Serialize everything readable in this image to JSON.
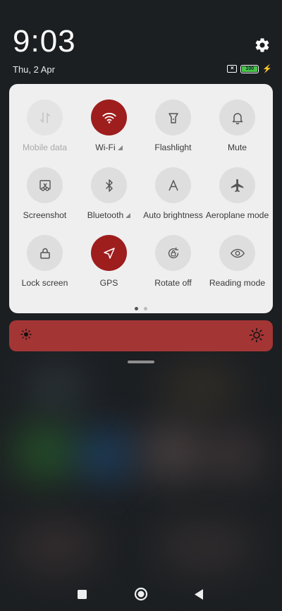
{
  "status": {
    "time": "9:03",
    "date": "Thu, 2 Apr",
    "battery_level": "100",
    "settings_icon": "gear-icon"
  },
  "quick_settings": {
    "tiles": [
      {
        "label": "Mobile data",
        "icon": "mobile-data-icon",
        "state": "disabled"
      },
      {
        "label": "Wi-Fi",
        "icon": "wifi-icon",
        "state": "on",
        "expandable": true
      },
      {
        "label": "Flashlight",
        "icon": "flashlight-icon",
        "state": "off"
      },
      {
        "label": "Mute",
        "icon": "bell-icon",
        "state": "off"
      },
      {
        "label": "Screenshot",
        "icon": "scissors-icon",
        "state": "off"
      },
      {
        "label": "Bluetooth",
        "icon": "bluetooth-icon",
        "state": "off",
        "expandable": true
      },
      {
        "label": "Auto brightness",
        "icon": "auto-brightness-icon",
        "state": "off"
      },
      {
        "label": "Aeroplane mode",
        "icon": "airplane-icon",
        "state": "off"
      },
      {
        "label": "Lock screen",
        "icon": "lock-icon",
        "state": "off"
      },
      {
        "label": "GPS",
        "icon": "location-arrow-icon",
        "state": "on"
      },
      {
        "label": "Rotate off",
        "icon": "rotate-lock-icon",
        "state": "off"
      },
      {
        "label": "Reading mode",
        "icon": "eye-icon",
        "state": "off"
      }
    ],
    "page_count": 2,
    "active_page": 1
  },
  "brightness": {
    "level": 1.0,
    "color": "#a43535"
  },
  "colors": {
    "accent": "#9e1d1d",
    "panel": "#efefef",
    "tile_off": "#dedede"
  },
  "navigation": {
    "buttons": [
      "recents-square-icon",
      "home-circle-icon",
      "back-triangle-icon"
    ]
  }
}
